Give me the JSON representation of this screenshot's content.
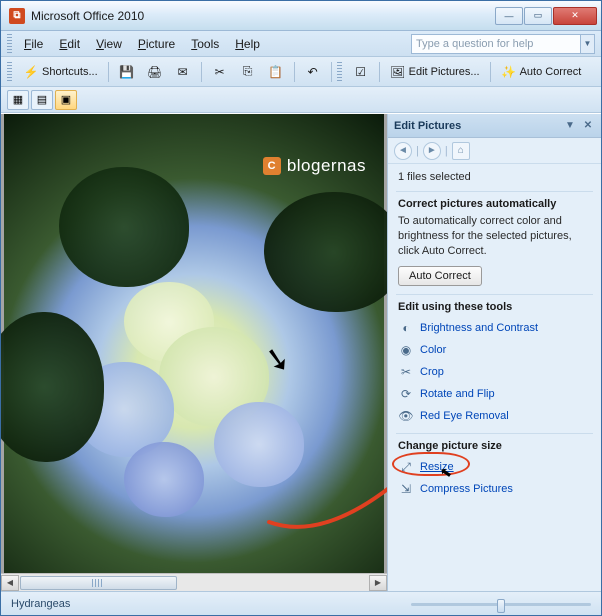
{
  "titlebar": {
    "app_title": "Microsoft Office 2010"
  },
  "menubar": {
    "file": "File",
    "edit": "Edit",
    "view": "View",
    "picture": "Picture",
    "tools": "Tools",
    "help": "Help",
    "help_placeholder": "Type a question for help"
  },
  "toolbar": {
    "shortcuts": "Shortcuts...",
    "edit_pictures": "Edit Pictures...",
    "auto_correct": "Auto Correct"
  },
  "canvas": {
    "watermark_text": "blogernas",
    "watermark_badge": "C"
  },
  "status": {
    "filename": "Hydrangeas"
  },
  "panel": {
    "title": "Edit Pictures",
    "files_selected": "1 files selected",
    "sec_auto_title": "Correct pictures automatically",
    "auto_desc": "To automatically correct color and brightness for the selected pictures, click Auto Correct.",
    "auto_btn": "Auto Correct",
    "sec_tools_title": "Edit using these tools",
    "tools": {
      "brightness": "Brightness and Contrast",
      "color": "Color",
      "crop": "Crop",
      "rotate": "Rotate and Flip",
      "redeye": "Red Eye Removal"
    },
    "sec_size_title": "Change picture size",
    "size_tools": {
      "resize": "Resize",
      "compress": "Compress Pictures"
    }
  }
}
